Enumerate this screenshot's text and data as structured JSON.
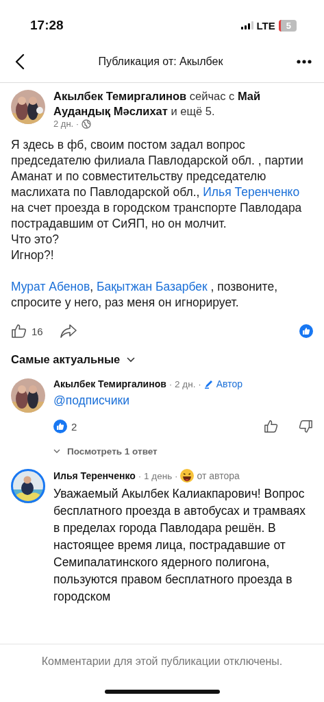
{
  "status_bar": {
    "time": "17:28",
    "network": "LTE",
    "battery": "5"
  },
  "nav": {
    "title": "Публикация от: Акылбек"
  },
  "post": {
    "author": "Акылбек Темиргалинов",
    "with_text": "сейчас с",
    "tagged": "Май Аудандық Мәслихат",
    "and_more": "и ещё 5.",
    "time": "2 дн. ·",
    "paragraphs": [
      {
        "segments": [
          {
            "text": "Я здесь в фб, своим постом задал вопрос председателю филиала  Павлодарской обл. , партии Аманат и по совместительству председателю маслихата по Павлодарской обл., ",
            "link": false
          },
          {
            "text": "Илья Теренченко",
            "link": true
          },
          {
            "text": "  на счет проезда в городском транспорте Павлодара пострадавшим от СиЯП, но он молчит.",
            "link": false
          }
        ]
      },
      {
        "segments": [
          {
            "text": "Что это?",
            "link": false
          }
        ]
      },
      {
        "segments": [
          {
            "text": "Игнор?!",
            "link": false
          }
        ]
      }
    ],
    "mentions": {
      "segments": [
        {
          "text": "Мурат Абенов",
          "link": true
        },
        {
          "text": ", ",
          "link": false
        },
        {
          "text": "Бақытжан Базарбек",
          "link": true
        },
        {
          "text": " , позвоните, спросите у него, раз меня он игнорирует.",
          "link": false
        }
      ]
    },
    "likes": "16"
  },
  "sort": {
    "label": "Самые актуальные"
  },
  "comments": [
    {
      "author": "Акылбек Темиргалинов",
      "time": "· 2 дн. ·",
      "badge": {
        "kind": "author",
        "text": "Автор"
      },
      "avatar_ring": false,
      "text": "@подписчики",
      "link": true,
      "likes": "2",
      "replies": "Посмотреть 1 ответ"
    },
    {
      "author": "Илья Теренченко",
      "time": "· 1 день ·",
      "badge": {
        "kind": "reaction",
        "text": "от автора"
      },
      "avatar_ring": true,
      "text": "Уважаемый Акылбек Калиакпарович! Вопрос бесплатного проезда в автобусах и трамваях в пределах города Павлодара решён. В настоящее время лица, пострадавшие от Семипалатинского ядерного полигона, пользуются правом бесплатного проезда в городском",
      "link": false
    }
  ],
  "footer": {
    "text": "Комментарии для этой публикации отключены."
  }
}
